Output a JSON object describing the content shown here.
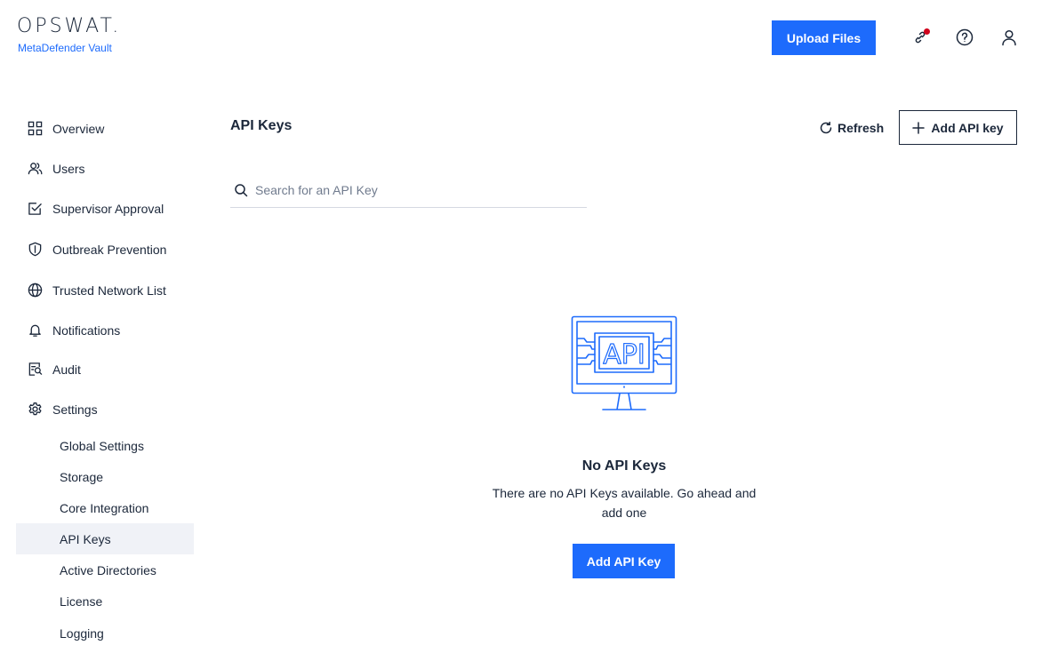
{
  "brand": {
    "logo_text": "OPSWAT.",
    "product_name": "MetaDefender Vault",
    "accent_color": "#1d6bfc"
  },
  "header": {
    "upload_label": "Upload Files",
    "icons": [
      "notification-link-icon",
      "help-icon",
      "user-icon"
    ],
    "notification_dot_color": "#d0021b"
  },
  "sidebar": {
    "items": [
      {
        "label": "Overview",
        "icon": "grid-icon"
      },
      {
        "label": "Users",
        "icon": "users-icon"
      },
      {
        "label": "Supervisor Approval",
        "icon": "approval-icon"
      },
      {
        "label": "Outbreak Prevention",
        "icon": "shield-icon"
      },
      {
        "label": "Trusted Network List",
        "icon": "globe-icon"
      },
      {
        "label": "Notifications",
        "icon": "bell-icon"
      },
      {
        "label": "Audit",
        "icon": "audit-icon"
      },
      {
        "label": "Settings",
        "icon": "gear-icon"
      }
    ],
    "settings_subitems": [
      {
        "label": "Global Settings"
      },
      {
        "label": "Storage"
      },
      {
        "label": "Core Integration"
      },
      {
        "label": "API Keys",
        "active": true
      },
      {
        "label": "Active Directories"
      },
      {
        "label": "License"
      },
      {
        "label": "Logging"
      }
    ]
  },
  "main": {
    "title": "API Keys",
    "refresh_label": "Refresh",
    "add_key_label": "Add API key",
    "search": {
      "placeholder": "Search for an API Key",
      "value": ""
    },
    "empty_state": {
      "illustration_text": "API",
      "title": "No API Keys",
      "description": "There are no API Keys available. Go ahead and add one",
      "button_label": "Add API Key"
    }
  }
}
